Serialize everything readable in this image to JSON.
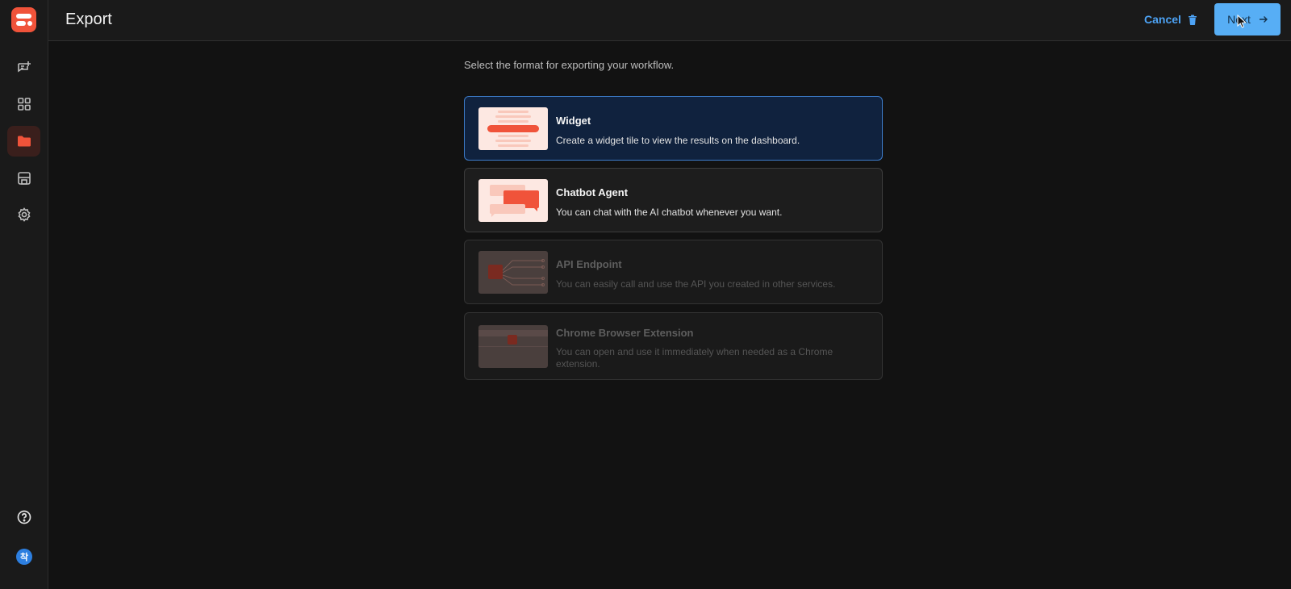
{
  "header": {
    "title": "Export",
    "cancel_label": "Cancel",
    "next_label": "Next"
  },
  "sidebar": {
    "items": [
      {
        "icon": "chat-add-icon"
      },
      {
        "icon": "grid-icon"
      },
      {
        "icon": "folder-icon",
        "active": true
      },
      {
        "icon": "store-icon"
      },
      {
        "icon": "gear-icon"
      }
    ],
    "help_icon": "help-icon",
    "avatar_initial": "착"
  },
  "main": {
    "intro": "Select the format for exporting your workflow.",
    "options": [
      {
        "title": "Widget",
        "description": "Create a widget tile to view the results on the dashboard.",
        "state": "selected"
      },
      {
        "title": "Chatbot Agent",
        "description": "You can chat with the AI chatbot whenever you want.",
        "state": "enabled"
      },
      {
        "title": "API Endpoint",
        "description": "You can easily call and use the API you created in other services.",
        "state": "disabled"
      },
      {
        "title": "Chrome Browser Extension",
        "description": "You can open and use it immediately when needed as a Chrome extension.",
        "state": "disabled"
      }
    ]
  },
  "colors": {
    "accent": "#f0533a",
    "primary_button": "#57aef5",
    "link": "#4da3f5",
    "selected_card": "#10223e"
  }
}
